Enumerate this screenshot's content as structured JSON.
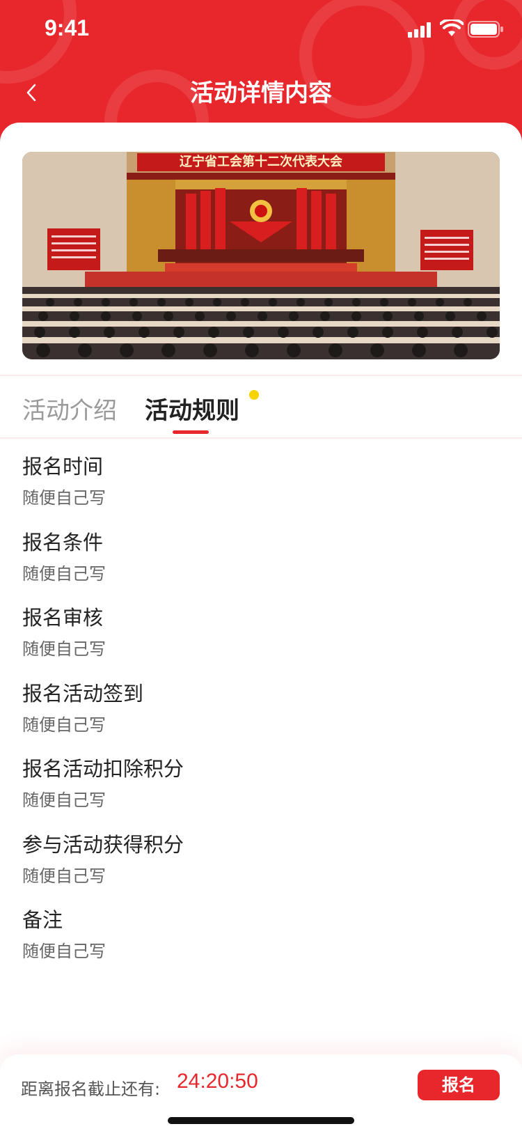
{
  "status_bar": {
    "time": "9:41"
  },
  "nav": {
    "title": "活动详情内容"
  },
  "banner": {
    "image_caption": "辽宁省工会第十二次代表大会"
  },
  "tabs": [
    {
      "label": "活动介绍",
      "active": false
    },
    {
      "label": "活动规则",
      "active": true
    }
  ],
  "rules": [
    {
      "title": "报名时间",
      "desc": "随便自己写"
    },
    {
      "title": "报名条件",
      "desc": "随便自己写"
    },
    {
      "title": "报名审核",
      "desc": "随便自己写"
    },
    {
      "title": "报名活动签到",
      "desc": "随便自己写"
    },
    {
      "title": "报名活动扣除积分",
      "desc": "随便自己写"
    },
    {
      "title": "参与活动获得积分",
      "desc": "随便自己写"
    },
    {
      "title": "备注",
      "desc": "随便自己写"
    }
  ],
  "footer": {
    "deadline_label": "距离报名截止还有:",
    "countdown": "24:20:50",
    "signup_label": "报名"
  },
  "colors": {
    "brand_red": "#e8272d",
    "notice_dot": "#f7d300"
  }
}
